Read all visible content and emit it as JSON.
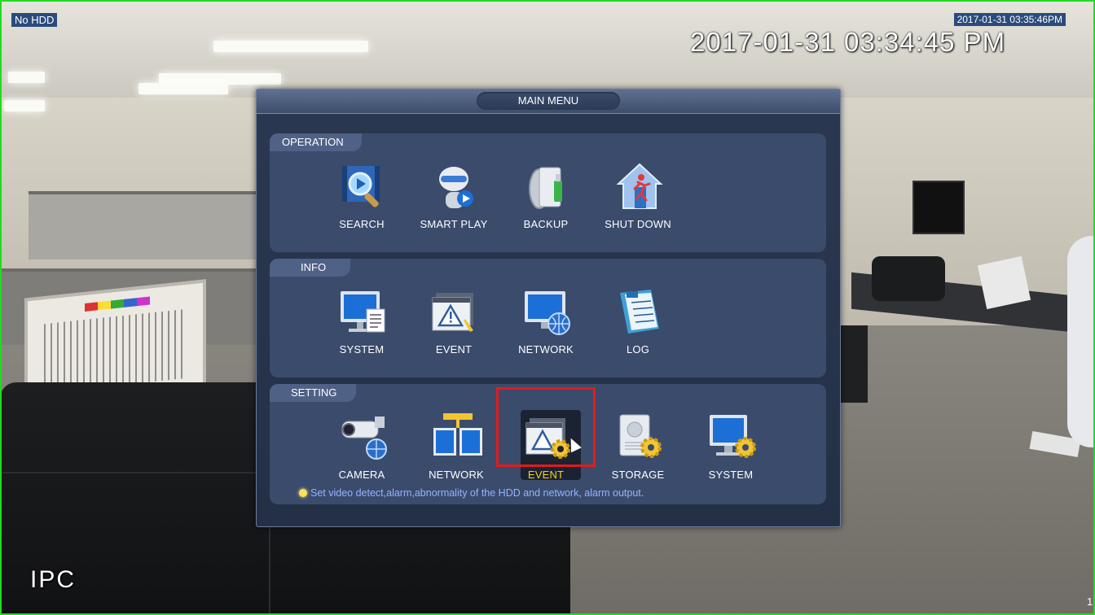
{
  "osd": {
    "hdd_status": "No HDD",
    "small_timestamp": "2017-01-31 03:35:46PM",
    "big_timestamp": "2017-01-31 03:34:45 PM",
    "camera_label": "IPC",
    "channel_number": "1"
  },
  "menu": {
    "title": "MAIN MENU",
    "sections": {
      "operation": {
        "label": "OPERATION",
        "items": [
          {
            "label": "SEARCH",
            "icon": "search-film-icon"
          },
          {
            "label": "SMART PLAY",
            "icon": "robot-play-icon"
          },
          {
            "label": "BACKUP",
            "icon": "usb-disc-icon"
          },
          {
            "label": "SHUT DOWN",
            "icon": "running-man-house-icon"
          }
        ]
      },
      "info": {
        "label": "INFO",
        "items": [
          {
            "label": "SYSTEM",
            "icon": "monitor-document-icon"
          },
          {
            "label": "EVENT",
            "icon": "warning-window-icon"
          },
          {
            "label": "NETWORK",
            "icon": "monitor-globe-icon"
          },
          {
            "label": "LOG",
            "icon": "notebook-icon"
          }
        ]
      },
      "setting": {
        "label": "SETTING",
        "items": [
          {
            "label": "CAMERA",
            "icon": "camera-globe-icon"
          },
          {
            "label": "NETWORK",
            "icon": "network-monitors-icon"
          },
          {
            "label": "EVENT",
            "icon": "warning-gear-icon",
            "selected": true
          },
          {
            "label": "STORAGE",
            "icon": "hdd-gear-icon"
          },
          {
            "label": "SYSTEM",
            "icon": "monitor-gear-icon"
          }
        ]
      }
    },
    "hint": "Set video detect,alarm,abnormality of the HDD and network, alarm output."
  },
  "colors": {
    "selection_border": "#e31b1b",
    "selected_label": "#f5d312",
    "hint_text": "#8fb6ff",
    "frame_border": "#1fdc1f"
  }
}
